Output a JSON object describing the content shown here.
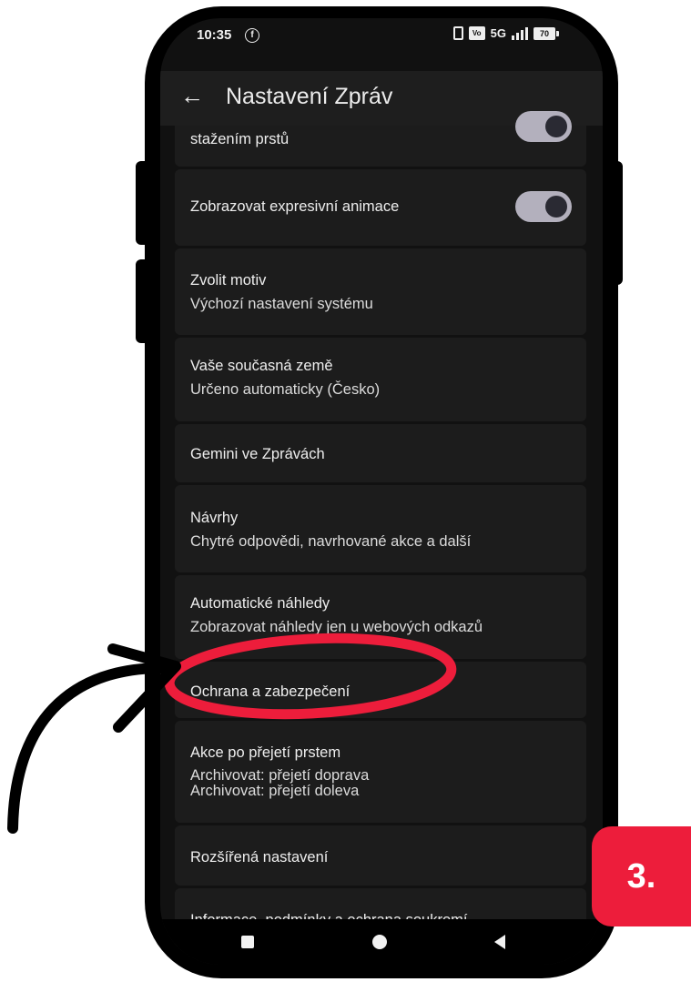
{
  "status_bar": {
    "time": "10:35",
    "network": "5G",
    "battery": "70"
  },
  "header": {
    "title": "Nastavení Zpráv"
  },
  "settings": [
    {
      "title": "stažením prstů",
      "subtitle": "",
      "toggle": true
    },
    {
      "title": "Zobrazovat expresivní animace",
      "subtitle": "",
      "toggle": true
    },
    {
      "title": "Zvolit motiv",
      "subtitle": "Výchozí nastavení systému"
    },
    {
      "title": "Vaše současná země",
      "subtitle": "Určeno automaticky (Česko)"
    },
    {
      "title": "Gemini ve Zprávách",
      "subtitle": ""
    },
    {
      "title": "Návrhy",
      "subtitle": "Chytré odpovědi, navrhované akce a další"
    },
    {
      "title": "Automatické náhledy",
      "subtitle": "Zobrazovat náhledy jen u webových odkazů"
    },
    {
      "title": "Ochrana a zabezpečení",
      "subtitle": ""
    },
    {
      "title": "Akce po přejetí prstem",
      "subtitle": "Archivovat: přejetí doprava",
      "subtitle2": "Archivovat: přejetí doleva"
    },
    {
      "title": "Rozšířená nastavení",
      "subtitle": ""
    },
    {
      "title": "Informace, podmínky a ochrana soukromí",
      "subtitle": ""
    }
  ],
  "annotation": {
    "step_label": "3.",
    "highlight_color": "#ed1d3b",
    "arrow_color": "#000000"
  },
  "colors": {
    "background": "#111111",
    "row": "#1c1c1c",
    "toggle_track": "#b3b0bd",
    "badge": "#ed1d3b"
  }
}
